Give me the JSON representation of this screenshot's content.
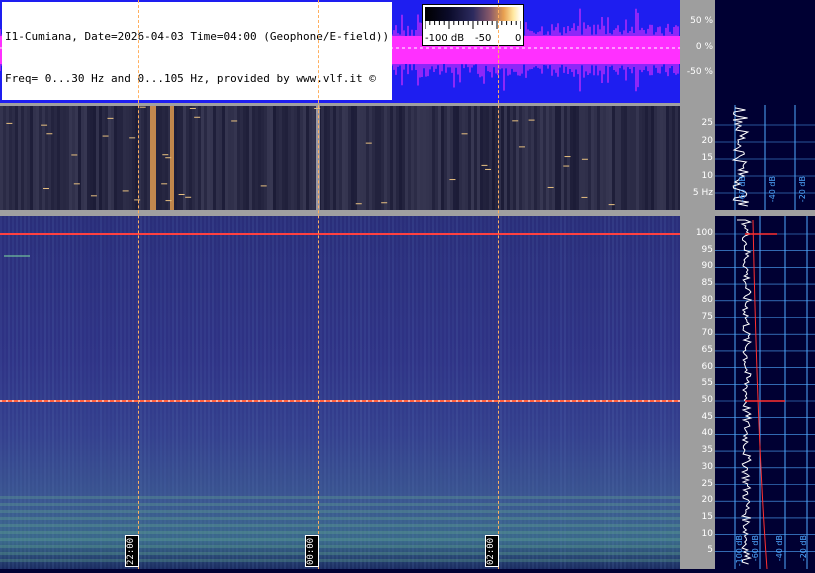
{
  "header": {
    "title_line1": "I1-Cumiana, Date=2026-04-03 Time=04:00 (Geophone/E-field))",
    "title_line2": "Freq= 0...30 Hz and 0...105 Hz, provided by www.vlf.it ©"
  },
  "colorbar": {
    "label_min": "-100 dB",
    "label_mid": "-50",
    "label_max": "0"
  },
  "waveform_axis": {
    "labels": [
      "50 %",
      "0 %",
      "-50 %"
    ]
  },
  "upper_axis": {
    "labels": [
      "25",
      "20",
      "15",
      "10",
      "5 Hz"
    ]
  },
  "lower_axis": {
    "labels": [
      "100",
      "95",
      "90",
      "85",
      "80",
      "75",
      "70",
      "65",
      "60",
      "55",
      "50",
      "45",
      "40",
      "35",
      "30",
      "25",
      "20",
      "15",
      "10",
      "5"
    ]
  },
  "time_markers": [
    "22:00",
    "00:00",
    "02:00"
  ],
  "side_panel": {
    "upper_db_labels": [
      "-60 dB",
      "-40 dB",
      "-20 dB"
    ],
    "lower_db_labels": [
      "-100 dB",
      "-60 dB",
      "-40 dB",
      "-20 dB"
    ]
  },
  "colors": {
    "waveform_bg": "#1e1ef0",
    "waveform_trace": "#ff30ff",
    "marker": "#ffb060",
    "axis_bg": "#9e9e9e",
    "panel_bg": "#000033",
    "grid": "#4fa8ff"
  }
}
